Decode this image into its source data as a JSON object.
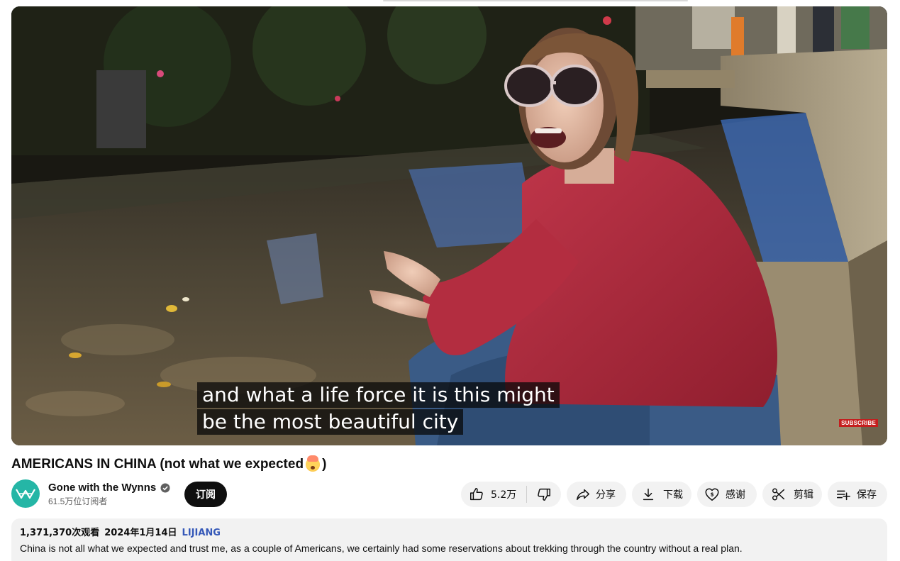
{
  "player": {
    "subtitle_line1": "and what a life force it is this might",
    "subtitle_line2": "be the most beautiful city",
    "watermark": "SUBSCRIBE"
  },
  "video": {
    "title": "AMERICANS IN CHINA (not what we expected",
    "title_close": ")",
    "title_emoji": "exploding-head-emoji"
  },
  "channel": {
    "name": "Gone with the Wynns",
    "subscribers": "61.5万位订阅者",
    "avatar_color": "#25b6a6",
    "verified_icon": "verified-check-icon"
  },
  "actions": {
    "subscribe_label": "订阅",
    "like_count": "5.2万",
    "share_label": "分享",
    "download_label": "下载",
    "thanks_label": "感谢",
    "clip_label": "剪辑",
    "save_label": "保存"
  },
  "description": {
    "views": "1,371,370次观看",
    "date": "2024年1月14日",
    "location": "LIJIANG",
    "text": "China is not all what we expected and trust me, as a couple of Americans, we certainly had some reservations about trekking through the country without a real plan."
  },
  "colors": {
    "subscribe_bg": "#0f0f0f",
    "pill_bg": "#f2f2f2",
    "location_link": "#3558b8"
  }
}
